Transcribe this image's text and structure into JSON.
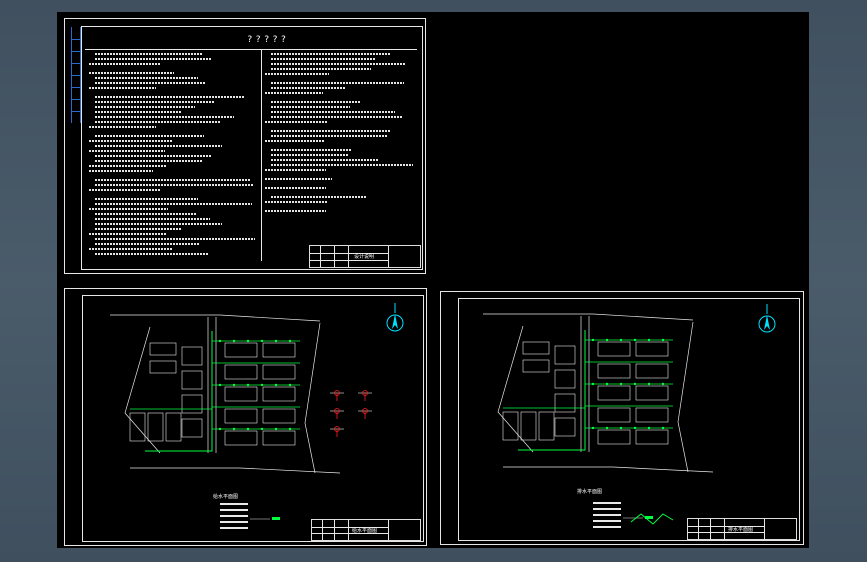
{
  "window": {
    "background_color": "#46576a",
    "canvas_color": "#000000"
  },
  "sheets": [
    {
      "id": "design-notes",
      "title": "?????",
      "title_block_label": "设计说明",
      "line_color": "#ffffff"
    },
    {
      "id": "plan-left",
      "north_label": "N",
      "plan_title": "给水平面图",
      "title_block_label": "给水平面图"
    },
    {
      "id": "plan-right",
      "north_label": "N",
      "plan_title": "排水平面图",
      "title_block_label": "排水平面图"
    }
  ],
  "colors": {
    "accent_green": "#00ff40",
    "accent_red": "#ff2020",
    "accent_cyan": "#00e0ff",
    "ruler_blue": "#2a6ad0"
  },
  "icons": [
    "north-arrow-icon"
  ]
}
